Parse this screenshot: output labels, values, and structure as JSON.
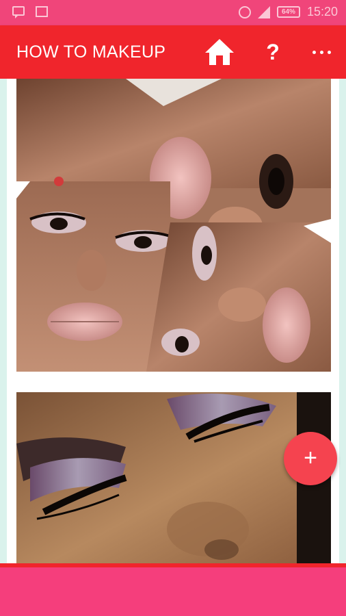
{
  "status_bar": {
    "battery": "64%",
    "time": "15:20"
  },
  "app_bar": {
    "title": "HOW TO MAKEUP",
    "home_icon": "home-icon",
    "help_label": "?",
    "more_icon": "more-vert-icon"
  },
  "feed": {
    "images": [
      {
        "description": "makeup tutorial collage"
      },
      {
        "description": "smoky eye closeup"
      }
    ]
  },
  "fab": {
    "label": "+"
  },
  "colors": {
    "status_bar": "#f0457a",
    "app_bar": "#f0252c",
    "fab": "#f5434f",
    "bottom_bar": "#f53e7c",
    "page_edge": "#daf2ec"
  }
}
